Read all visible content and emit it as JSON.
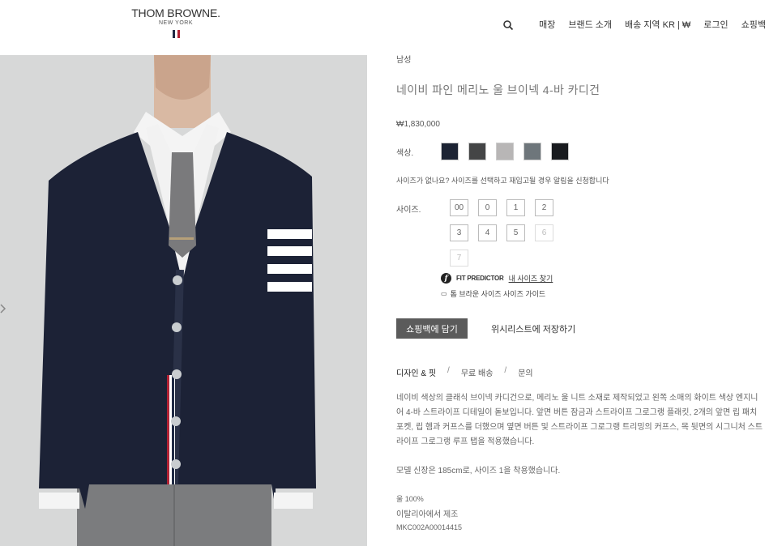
{
  "header": {
    "logo_main": "THOM BROWNE.",
    "logo_sub": "NEW YORK",
    "flag_colors": [
      "#1f2a44",
      "#ffffff",
      "#b22234"
    ],
    "nav": [
      "매장",
      "브랜드 소개",
      "배송 지역 KR | ₩",
      "로그인",
      "쇼핑백"
    ]
  },
  "product": {
    "breadcrumb": "남성",
    "title": "네이비 파인 메리노 울 브이넥 4-바 카디건",
    "price": "₩1,830,000",
    "color_label": "색상.",
    "colors": [
      "#1c2333",
      "#444546",
      "#b8b6b6",
      "#6e767b",
      "#191b1f"
    ],
    "size_notice": "사이즈가 없나요? 사이즈를 선택하고 재입고될 경우 알림을 신청합니다",
    "size_label": "사이즈.",
    "sizes": [
      {
        "label": "00",
        "available": true
      },
      {
        "label": "0",
        "available": true
      },
      {
        "label": "1",
        "available": true
      },
      {
        "label": "2",
        "available": true
      },
      {
        "label": "3",
        "available": true
      },
      {
        "label": "4",
        "available": true
      },
      {
        "label": "5",
        "available": true
      },
      {
        "label": "6",
        "available": false
      },
      {
        "label": "7",
        "available": false
      }
    ],
    "fit_predictor": "FIT PREDICTOR",
    "fit_link": "내 사이즈 찾기",
    "size_guide": "톰 브라운 사이즈 사이즈 가이드",
    "add_to_bag": "쇼핑백에 담기",
    "wishlist": "위시리스트에 저장하기",
    "tabs": [
      "디자인 & 핏",
      "무료 배송",
      "문의"
    ],
    "description": "네이비 색상의 클래식 브이넥 카디건으로, 메리노 울 니트 소재로 제작되었고 왼쪽 소매의 화이트 색상 엔지니어 4-바 스트라이프 디테일이 돋보입니다. 앞면 버튼 잠금과 스트라이프 그로그랭 플래킷, 2개의 앞면 립 패치 포켓, 립 헴과 커프스를 더했으며 옆면 버튼 및 스트라이프 그로그랭 트리밍의 커프스, 목 뒷면의 시그니처 스트라이프 그로그랭 루프 탭을 적용했습니다.",
    "model_info": "모델 신장은 185cm로, 사이즈 1을 착용했습니다.",
    "material": "울 100%",
    "origin": "이탈리아에서 제조",
    "sku": "MKC002A00014415"
  }
}
